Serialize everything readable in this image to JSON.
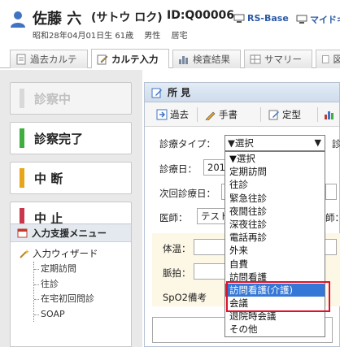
{
  "patient": {
    "name": "佐藤 六",
    "kana": "(サトウ ロク)",
    "id": "ID:Q00006",
    "birth": "昭和28年04月01日生 61歳",
    "sex": "男性",
    "residence": "居宅",
    "links": [
      "RS-Base",
      "マイドキ"
    ]
  },
  "tabs": [
    "過去カルテ",
    "カルテ入力",
    "検査結果",
    "サマリー",
    "図"
  ],
  "active_tab": "カルテ入力",
  "side_buttons": [
    {
      "label": "診察中",
      "color": "#d9d9d9",
      "disabled": true
    },
    {
      "label": "診察完了",
      "color": "#3fae3f",
      "disabled": false
    },
    {
      "label": "中 断",
      "color": "#e7a51a",
      "disabled": false
    },
    {
      "label": "中 止",
      "color": "#c8374c",
      "disabled": false
    }
  ],
  "menu": {
    "title": "入力支援メニュー",
    "wizard": "入力ウィザード",
    "items": [
      "定期訪問",
      "往診",
      "在宅初回問診",
      "SOAP"
    ]
  },
  "panel": {
    "title": "所 見",
    "toolbar": [
      "過去",
      "手書",
      "定型"
    ],
    "fields": {
      "type_label": "診療タイプ：",
      "type_value": "▼選択",
      "date_label": "診療日：",
      "date_value": "201",
      "next_label": "次回診療日：",
      "doctor_label": "医師：",
      "doctor_value": "テスト",
      "doctor_extra": "師：",
      "temp_label": "体温：",
      "pulse_label": "脈拍：",
      "spo2_label": "SpO2備考",
      "side_char": "診"
    }
  },
  "dropdown": {
    "options": [
      "▼選択",
      "定期訪問",
      "往診",
      "緊急往診",
      "夜間往診",
      "深夜往診",
      "電話再診",
      "外来",
      "自費",
      "訪問看護",
      "訪問看護(介護)",
      "会議",
      "退院時会議",
      "その他"
    ],
    "highlighted": "訪問看護(介護)"
  }
}
